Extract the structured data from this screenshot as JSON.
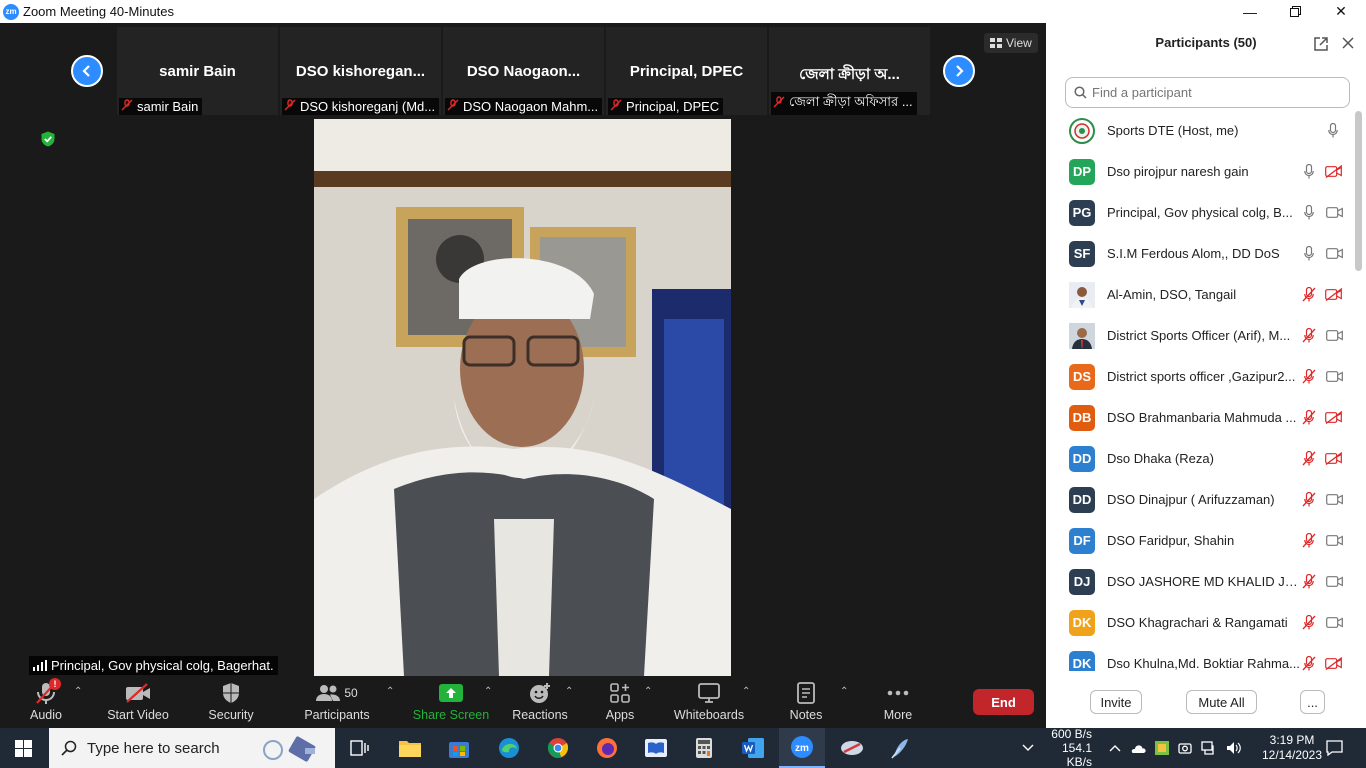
{
  "window": {
    "title": "Zoom Meeting 40-Minutes",
    "logo_text": "zm"
  },
  "strip": {
    "tiles": [
      {
        "name": "samir Bain",
        "label": "samir Bain"
      },
      {
        "name": "DSO  kishoregan...",
        "label": "DSO kishoreganj (Md..."
      },
      {
        "name": "DSO  Naogaon...",
        "label": "DSO Naogaon Mahm..."
      },
      {
        "name": "Principal,  DPEC",
        "label": "Principal,  DPEC"
      },
      {
        "name": "জেলা ক্রীড়া অ...",
        "label": "জেলা ক্রীড়া অফিসার ..."
      }
    ],
    "view_label": "View"
  },
  "speaker": {
    "label": "Principal,  Gov physical colg, Bagerhat."
  },
  "toolbar": {
    "audio": "Audio",
    "start_video": "Start Video",
    "security": "Security",
    "participants": "Participants",
    "participants_count": "50",
    "share_screen": "Share Screen",
    "reactions": "Reactions",
    "apps": "Apps",
    "whiteboards": "Whiteboards",
    "notes": "Notes",
    "more": "More",
    "end": "End",
    "audio_badge": "!"
  },
  "panel": {
    "title": "Participants (50)",
    "search_placeholder": "Find a participant",
    "invite": "Invite",
    "mute_all": "Mute All",
    "more": "...",
    "participants": [
      {
        "initials": "",
        "name": "Sports DTE (Host, me)",
        "color": "#ffffff",
        "mic": "on",
        "cam": "none",
        "photo": "logo"
      },
      {
        "initials": "DP",
        "name": "Dso pirojpur naresh gain",
        "color": "#23a55a",
        "mic": "on",
        "cam": "off"
      },
      {
        "initials": "PG",
        "name": "Principal,  Gov physical colg, B...",
        "color": "#2e3e52",
        "mic": "on",
        "cam": "on"
      },
      {
        "initials": "SF",
        "name": "S.I.M Ferdous Alom,, DD DoS",
        "color": "#2e3e52",
        "mic": "on",
        "cam": "on"
      },
      {
        "initials": "",
        "name": "Al-Amin, DSO, Tangail",
        "color": "#ffffff",
        "mic": "off",
        "cam": "off",
        "photo": "face1"
      },
      {
        "initials": "",
        "name": "District Sports Officer (Arif), M...",
        "color": "#ffffff",
        "mic": "off",
        "cam": "on",
        "photo": "face2"
      },
      {
        "initials": "DS",
        "name": "District sports officer ,Gazipur2...",
        "color": "#e8691a",
        "mic": "off",
        "cam": "on"
      },
      {
        "initials": "DB",
        "name": "DSO Brahmanbaria Mahmuda ...",
        "color": "#e05c0e",
        "mic": "off",
        "cam": "off"
      },
      {
        "initials": "DD",
        "name": "Dso Dhaka (Reza)",
        "color": "#2d7fd0",
        "mic": "off",
        "cam": "off"
      },
      {
        "initials": "DD",
        "name": "DSO Dinajpur ( Arifuzzaman)",
        "color": "#2e3e52",
        "mic": "off",
        "cam": "on"
      },
      {
        "initials": "DF",
        "name": "DSO Faridpur, Shahin",
        "color": "#2d7fd0",
        "mic": "off",
        "cam": "on"
      },
      {
        "initials": "DJ",
        "name": "DSO JASHORE MD KHALID JAH...",
        "color": "#2e3e52",
        "mic": "off",
        "cam": "on"
      },
      {
        "initials": "DK",
        "name": "DSO Khagrachari & Rangamati",
        "color": "#f0a21a",
        "mic": "off",
        "cam": "on"
      },
      {
        "initials": "DK",
        "name": "Dso Khulna,Md. Boktiar Rahma...",
        "color": "#2d7fd0",
        "mic": "off",
        "cam": "off"
      }
    ]
  },
  "taskbar": {
    "search_placeholder": "Type here to search",
    "net_up": "600 B/s",
    "net_down": "154.1 KB/s",
    "time": "3:19 PM",
    "date": "12/14/2023"
  },
  "colors": {
    "accent": "#2d8cff",
    "end": "#c2262b",
    "share": "#23b33a",
    "mic_off": "#e02828"
  }
}
